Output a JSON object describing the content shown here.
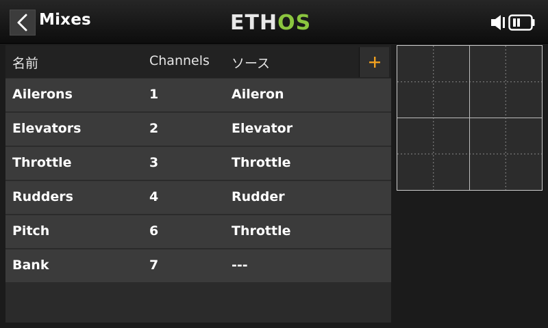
{
  "header": {
    "title": "Mixes",
    "brand": {
      "part1": "ETH",
      "part2": "OS"
    },
    "icons": {
      "back": "chevron-left-icon",
      "volume": "speaker-icon",
      "battery": "battery-icon"
    }
  },
  "table": {
    "columns": {
      "name": "名前",
      "channels": "Channels",
      "source": "ソース"
    },
    "add_label": "+",
    "rows": [
      {
        "name": "Ailerons",
        "channel": "1",
        "source": "Aileron"
      },
      {
        "name": "Elevators",
        "channel": "2",
        "source": "Elevator"
      },
      {
        "name": "Throttle",
        "channel": "3",
        "source": "Throttle"
      },
      {
        "name": "Rudders",
        "channel": "4",
        "source": "Rudder"
      },
      {
        "name": "Pitch",
        "channel": "6",
        "source": "Throttle"
      },
      {
        "name": "Bank",
        "channel": "7",
        "source": "---"
      }
    ]
  },
  "colors": {
    "accent_orange": "#f0a020",
    "brand_green": "#8bc53f",
    "row_bg": "#3b3b3b",
    "header_bg": "#222222"
  }
}
